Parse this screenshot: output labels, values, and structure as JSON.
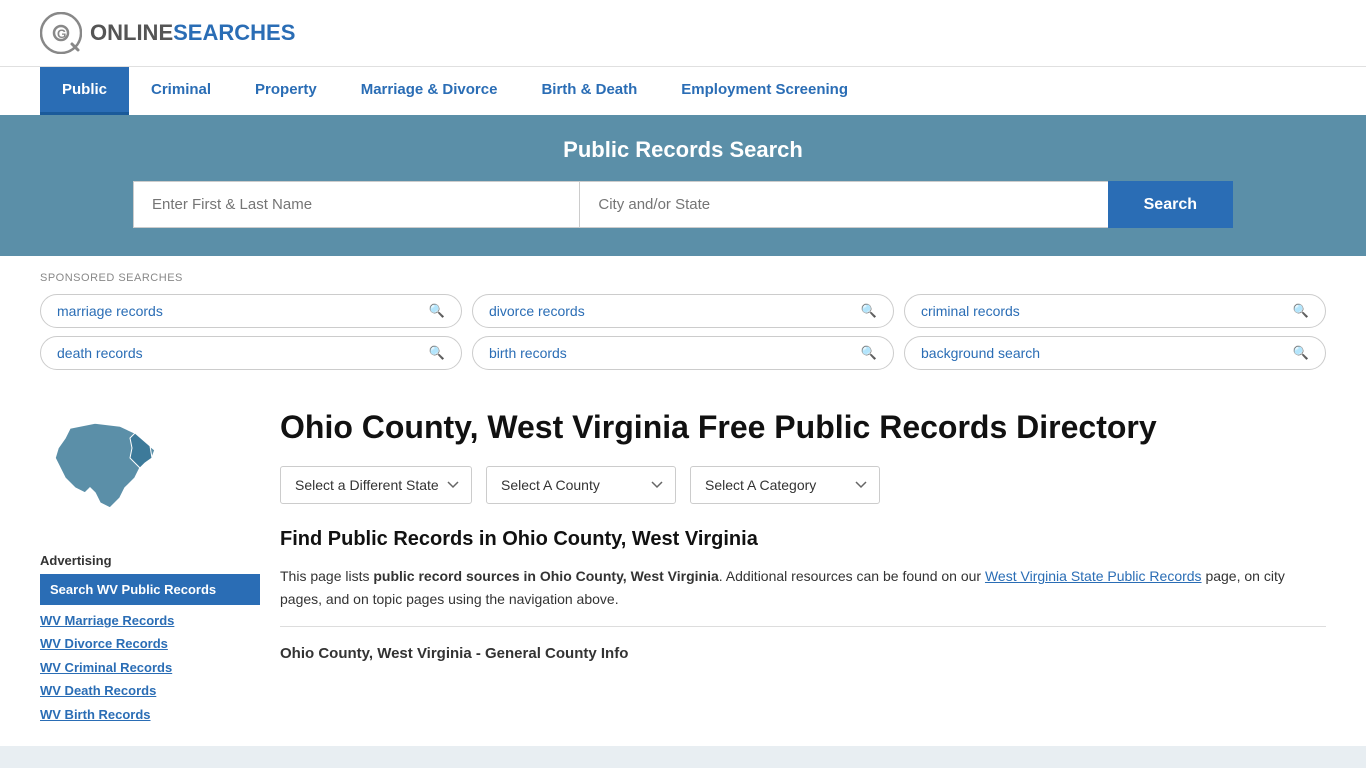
{
  "site": {
    "logo_online": "ONLINE",
    "logo_searches": "SEARCHES"
  },
  "nav": {
    "items": [
      {
        "label": "Public",
        "active": true
      },
      {
        "label": "Criminal",
        "active": false
      },
      {
        "label": "Property",
        "active": false
      },
      {
        "label": "Marriage & Divorce",
        "active": false
      },
      {
        "label": "Birth & Death",
        "active": false
      },
      {
        "label": "Employment Screening",
        "active": false
      }
    ]
  },
  "search_banner": {
    "title": "Public Records Search",
    "name_placeholder": "Enter First & Last Name",
    "city_placeholder": "City and/or State",
    "button_label": "Search"
  },
  "sponsored": {
    "label": "SPONSORED SEARCHES",
    "items": [
      "marriage records",
      "divorce records",
      "criminal records",
      "death records",
      "birth records",
      "background search"
    ]
  },
  "dropdowns": {
    "state": "Select a Different State",
    "county": "Select A County",
    "category": "Select A Category"
  },
  "page": {
    "title": "Ohio County, West Virginia Free Public Records Directory",
    "find_title": "Find Public Records in Ohio County, West Virginia",
    "find_desc_start": "This page lists ",
    "find_desc_bold": "public record sources in Ohio County, West Virginia",
    "find_desc_mid": ". Additional resources can be found on our ",
    "find_desc_link": "West Virginia State Public Records",
    "find_desc_end": " page, on city pages, and on topic pages using the navigation above.",
    "general_info_title": "Ohio County, West Virginia - General County Info"
  },
  "sidebar": {
    "advertising_label": "Advertising",
    "ad_highlight": "Search WV Public Records",
    "links": [
      "WV Marriage Records",
      "WV Divorce Records",
      "WV Criminal Records",
      "WV Death Records",
      "WV Birth Records"
    ]
  },
  "colors": {
    "accent_blue": "#2a6db5",
    "banner_blue": "#5b8fa8",
    "map_blue": "#5b8fa8"
  }
}
